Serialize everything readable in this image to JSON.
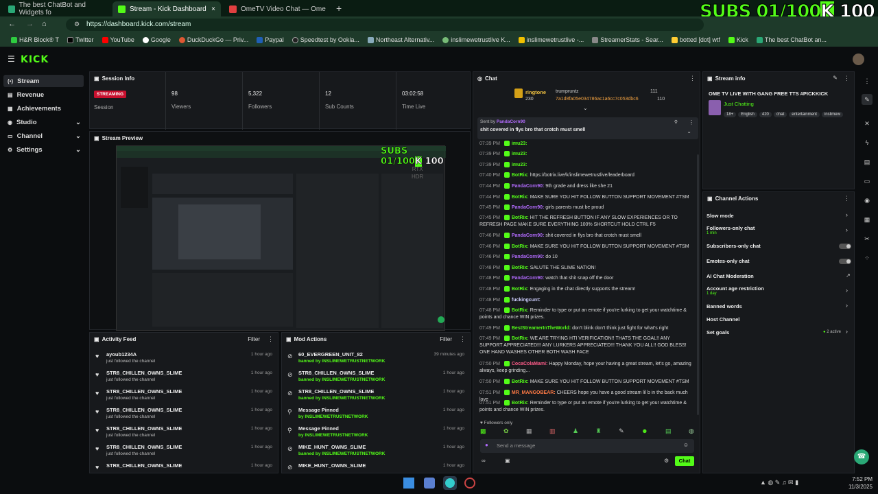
{
  "browser": {
    "tabs": [
      "The best ChatBot and Widgets fo",
      "Stream - Kick Dashboard",
      "OmeTV Video Chat — Ome"
    ],
    "url": "https://dashboard.kick.com/stream",
    "bookmarks": [
      "H&R Block® T",
      "Twitter",
      "YouTube",
      "Google",
      "DuckDuckGo — Priv...",
      "Paypal",
      "Speedtest by Ookla...",
      "Northeast Alternativ...",
      "inslimewetrustlive K...",
      "inslimewetrustlive -...",
      "StreamerStats - Sear...",
      "botted [dot] wtf",
      "Kick",
      "The best ChatBot an..."
    ],
    "overlay_subs": "SUBS 01/100",
    "overlay_k": "K",
    "overlay_count": "100"
  },
  "kick": {
    "logo": "KICK",
    "nav": [
      {
        "label": "Stream",
        "icon": "stream-icon"
      },
      {
        "label": "Revenue",
        "icon": "revenue-icon"
      },
      {
        "label": "Achievements",
        "icon": "achievements-icon"
      },
      {
        "label": "Studio",
        "icon": "studio-icon"
      },
      {
        "label": "Channel",
        "icon": "channel-icon"
      },
      {
        "label": "Settings",
        "icon": "settings-icon"
      }
    ]
  },
  "session": {
    "title": "Session Info",
    "status": "STREAMING",
    "status_label": "Session",
    "stats": [
      {
        "value": "98",
        "label": "Viewers"
      },
      {
        "value": "5,322",
        "label": "Followers"
      },
      {
        "value": "12",
        "label": "Sub Counts"
      },
      {
        "value": "03:02:58",
        "label": "Time Live"
      }
    ]
  },
  "preview": {
    "title": "Stream Preview",
    "overlay_text": "SUBS 01/100",
    "overlay_k": "K",
    "overlay_count": "100",
    "rtx": "RTX",
    "hdr": "HDR"
  },
  "activity": {
    "title": "Activity Feed",
    "filter": "Filter",
    "items": [
      {
        "name": "ayoub1234A",
        "sub": "just followed the channel",
        "time": "1 hour ago"
      },
      {
        "name": "STR8_CHILLEN_OWNS_SLIME",
        "sub": "just followed the channel",
        "time": "1 hour ago"
      },
      {
        "name": "STR8_CHILLEN_OWNS_SLIME",
        "sub": "just followed the channel",
        "time": "1 hour ago"
      },
      {
        "name": "STR8_CHILLEN_OWNS_SLIME",
        "sub": "just followed the channel",
        "time": "1 hour ago"
      },
      {
        "name": "STR8_CHILLEN_OWNS_SLIME",
        "sub": "just followed the channel",
        "time": "1 hour ago"
      },
      {
        "name": "STR8_CHILLEN_OWNS_SLIME",
        "sub": "just followed the channel",
        "time": "1 hour ago"
      },
      {
        "name": "STR8_CHILLEN_OWNS_SLIME",
        "sub": "",
        "time": "1 hour ago"
      }
    ]
  },
  "mod": {
    "title": "Mod Actions",
    "filter": "Filter",
    "items": [
      {
        "name": "60_EVERGREEN_UNIT_82",
        "sub": "banned by INSLIMEWETRUSTNETWORK",
        "time": "39 minutes ago",
        "icon": "ban-icon"
      },
      {
        "name": "STR8_CHILLEN_OWNS_SLIME",
        "sub": "banned by INSLIMEWETRUSTNETWORK",
        "time": "1 hour ago",
        "icon": "ban-icon"
      },
      {
        "name": "STR8_CHILLEN_OWNS_SLIME",
        "sub": "banned by INSLIMEWETRUSTNETWORK",
        "time": "1 hour ago",
        "icon": "ban-icon"
      },
      {
        "name": "Message Pinned",
        "sub": "by INSLIMEWETRUSTNETWORK",
        "time": "1 hour ago",
        "icon": "pin-icon"
      },
      {
        "name": "Message Pinned",
        "sub": "by INSLIMEWETRUSTNETWORK",
        "time": "1 hour ago",
        "icon": "pin-icon"
      },
      {
        "name": "MIKE_HUNT_OWNS_SLIME",
        "sub": "banned by INSLIMEWETRUSTNETWORK",
        "time": "1 hour ago",
        "icon": "ban-icon"
      },
      {
        "name": "MIKE_HUNT_OWNS_SLIME",
        "sub": "",
        "time": "1 hour ago",
        "icon": "ban-icon"
      }
    ]
  },
  "chat": {
    "title": "Chat",
    "top_user1": "ringtone",
    "top_user1_val": "230",
    "top_user2": "trumpruntz",
    "top_user2_val": "111",
    "top_user3": "7a1d8fa05e034786ac1a6cc7c053dbc6",
    "top_user3_val": "110",
    "pinned_by": "Sent by",
    "pinned_user": "PandaCorn90",
    "pinned_text": "shit covered in flys bro  that crotch must smell",
    "messages": [
      {
        "time": "07:39 PM",
        "user": "imu23:",
        "text": "",
        "color": "#53fc18"
      },
      {
        "time": "07:39 PM",
        "user": "imu23:",
        "text": "",
        "color": "#53fc18"
      },
      {
        "time": "07:39 PM",
        "user": "imu23:",
        "text": "",
        "color": "#53fc18"
      },
      {
        "time": "07:40 PM",
        "user": "BotRix:",
        "text": "https://botrix.live/k/inslimewetrustlive/leaderboard",
        "color": "#53fc18"
      },
      {
        "time": "07:44 PM",
        "user": "PandaCorn90:",
        "text": "9th grade and dress like she 21",
        "color": "#b36bff"
      },
      {
        "time": "07:44 PM",
        "user": "BotRix:",
        "text": "MAKE SURE YOU HIT FOLLOW BUTTON SUPPORT MOVEMENT #TSM",
        "color": "#53fc18"
      },
      {
        "time": "07:45 PM",
        "user": "PandaCorn90:",
        "text": "girls parents must be proud",
        "color": "#b36bff"
      },
      {
        "time": "07:45 PM",
        "user": "BotRix:",
        "text": "HIT THE REFRESH BUTTON IF ANY SLOW EXPERIENCES OR TO REFRESH PAGE MAKE SURE EVERYTHING 100% SHORTCUT HOLD CTRL F5",
        "color": "#53fc18"
      },
      {
        "time": "07:46 PM",
        "user": "PandaCorn90:",
        "text": "shit covered in flys bro  that crotch must smell",
        "color": "#b36bff"
      },
      {
        "time": "07:46 PM",
        "user": "BotRix:",
        "text": "MAKE SURE YOU HIT FOLLOW BUTTON SUPPORT MOVEMENT #TSM",
        "color": "#53fc18"
      },
      {
        "time": "07:46 PM",
        "user": "PandaCorn90:",
        "text": "do 10",
        "color": "#b36bff"
      },
      {
        "time": "07:48 PM",
        "user": "BotRix:",
        "text": "SALUTE THE SLIME NATION!",
        "color": "#53fc18"
      },
      {
        "time": "07:48 PM",
        "user": "PandaCorn90:",
        "text": "watch that shit snap off the door",
        "color": "#b36bff"
      },
      {
        "time": "07:48 PM",
        "user": "BotRix:",
        "text": "Engaging in the chat directly supports the stream!",
        "color": "#53fc18"
      },
      {
        "time": "07:48 PM",
        "user": "fuckingcunt:",
        "text": "",
        "color": "#cfcfff"
      },
      {
        "time": "07:48 PM",
        "user": "BotRix:",
        "text": "Reminder to type or put an emote if you're lurking to get your watchtime & points and chance WIN prizes.",
        "color": "#53fc18"
      },
      {
        "time": "07:49 PM",
        "user": "BestStreamerInTheWorld:",
        "text": "don't blink don't think just fight for what's right",
        "color": "#53fc18"
      },
      {
        "time": "07:49 PM",
        "user": "BotRix:",
        "text": "WE ARE TRYING HTI VERIFICATION!! THATS THE GOAL!! ANY SUPPORT APPRECIATED!!! ANY LURKERS APPRECIATED!!! THANK YOU ALL!! GOD BLESS! ONE HAND WASHES OTHER BOTH WASH FACE",
        "color": "#53fc18"
      },
      {
        "time": "07:50 PM",
        "user": "CocaColaMami:",
        "text": "Happy Monday, hope your having a great stream, let's go, amazing always, keep grinding...",
        "color": "#ff5c8a"
      },
      {
        "time": "07:50 PM",
        "user": "BotRix:",
        "text": "MAKE SURE YOU HIT FOLLOW BUTTON SUPPORT MOVEMENT #TSM",
        "color": "#53fc18"
      },
      {
        "time": "07:51 PM",
        "user": "MR_MANGOBEAR:",
        "text": "CHEERS hope you have a good stream lil b in the back much love",
        "color": "#ff7a45"
      },
      {
        "time": "07:51 PM",
        "user": "BotRix:",
        "text": "Reminder to type or put an emote if you're lurking to get your watchtime & points and chance WIN prizes.",
        "color": "#53fc18"
      }
    ],
    "followers_only": "Followers only",
    "placeholder": "Send a message",
    "send": "Chat"
  },
  "stream_info": {
    "title": "Stream info",
    "stream_title": "OME TV LIVE WITH GANG  FREE TTS #PICKKICK",
    "category": "Just Chatting",
    "tags": [
      "18+",
      "English",
      "420",
      "chat",
      "entertainment",
      "inslimew"
    ]
  },
  "channel_actions": {
    "title": "Channel Actions",
    "items": [
      {
        "label": "Slow mode",
        "sub": "",
        "control": "chevron"
      },
      {
        "label": "Followers-only chat",
        "sub": "1 min",
        "control": "chevron"
      },
      {
        "label": "Subscribers-only chat",
        "sub": "",
        "control": "toggle"
      },
      {
        "label": "Emotes-only chat",
        "sub": "",
        "control": "toggle"
      },
      {
        "label": "AI Chat Moderation",
        "sub": "",
        "control": "external"
      },
      {
        "label": "Account age restriction",
        "sub": "1 day",
        "control": "chevron"
      },
      {
        "label": "Banned words",
        "sub": "",
        "control": "chevron"
      },
      {
        "label": "Host Channel",
        "sub": "",
        "control": "none"
      },
      {
        "label": "Set goals",
        "sub": "",
        "control": "chevron",
        "badge": "2 active"
      }
    ]
  },
  "taskbar": {
    "time": "7:52 PM",
    "date": "11/3/2025"
  }
}
